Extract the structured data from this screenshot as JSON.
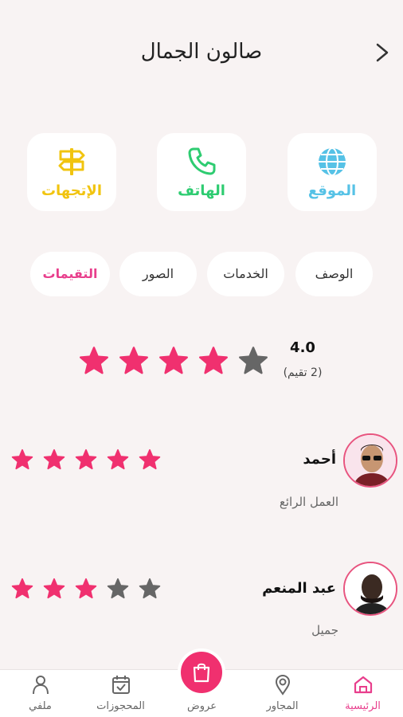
{
  "header": {
    "title": "صالون الجمال"
  },
  "actions": [
    {
      "label": "الموقع",
      "icon": "globe-icon",
      "color": "#56c2e6"
    },
    {
      "label": "الهاتف",
      "icon": "phone-icon",
      "color": "#2ecc71"
    },
    {
      "label": "الإتجهات",
      "icon": "signpost-icon",
      "color": "#f1c40f"
    }
  ],
  "tabs": [
    {
      "label": "الوصف",
      "active": false
    },
    {
      "label": "الخدمات",
      "active": false
    },
    {
      "label": "الصور",
      "active": false
    },
    {
      "label": "التقيمات",
      "active": true
    }
  ],
  "summary": {
    "value": "4.0",
    "count_label": "(2 تقيم)",
    "stars": 4,
    "max": 5
  },
  "reviews": [
    {
      "name": "أحمد",
      "text": "العمل الرائع",
      "stars": 5,
      "max": 5
    },
    {
      "name": "عبد المنعم",
      "text": "جميل",
      "stars": 3,
      "max": 5
    }
  ],
  "nav": {
    "home": "الرئيسية",
    "nearby": "المجاور",
    "offers": "عروض",
    "bookings": "المحجوزات",
    "profile": "ملفي"
  },
  "colors": {
    "accent": "#e83e8c",
    "star_on": "#f0306f",
    "star_off": "#666666",
    "background": "#f8f3f3"
  }
}
